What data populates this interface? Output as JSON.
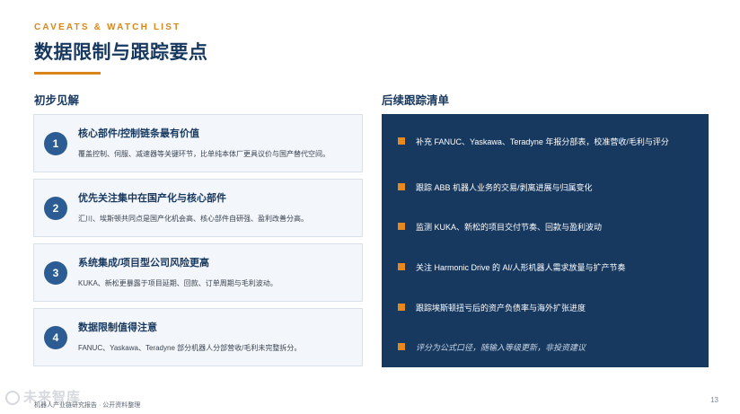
{
  "header": {
    "eyebrow": "CAVEATS & WATCH LIST",
    "title": "数据限制与跟踪要点"
  },
  "left_section": {
    "title": "初步见解",
    "cards": [
      {
        "number": "1",
        "title": "核心部件/控制链条最有价值",
        "desc": "覆盖控制、伺服、减速器等关键环节，比单纯本体厂更具议价与国产替代空间。"
      },
      {
        "number": "2",
        "title": "优先关注集中在国产化与核心部件",
        "desc": "汇川、埃斯顿共同点是国产化机会高、核心部件自研强、盈利改善分高。"
      },
      {
        "number": "3",
        "title": "系统集成/项目型公司风险更高",
        "desc": "KUKA、新松更暴露于项目延期、回款、订单周期与毛利波动。"
      },
      {
        "number": "4",
        "title": "数据限制值得注意",
        "desc": "FANUC、Yaskawa、Teradyne 部分机器人分部营收/毛利未完整拆分。"
      }
    ]
  },
  "right_section": {
    "title": "后续跟踪清单",
    "items": [
      {
        "text": "补充 FANUC、Yaskawa、Teradyne 年报分部表，校准营收/毛利与评分",
        "italic": false
      },
      {
        "text": "跟踪 ABB 机器人业务的交易/剥离进展与归属变化",
        "italic": false
      },
      {
        "text": "监测 KUKA、新松的项目交付节奏、回款与盈利波动",
        "italic": false
      },
      {
        "text": "关注 Harmonic Drive 的 AI/人形机器人需求放量与扩产节奏",
        "italic": false
      },
      {
        "text": "跟踪埃斯顿扭亏后的资产负债率与海外扩张进度",
        "italic": false
      },
      {
        "text": "评分为公式口径，随输入等级更新，非投资建议",
        "italic": true
      }
    ]
  },
  "footer": {
    "watermark": "未来智库",
    "source": "机器人产业链研究报告 · 公开资料整理",
    "page": "13"
  },
  "colors": {
    "accent": "#d9861c",
    "navy": "#17385f",
    "badge": "#2b5c93",
    "card_bg": "#f3f6fa"
  }
}
